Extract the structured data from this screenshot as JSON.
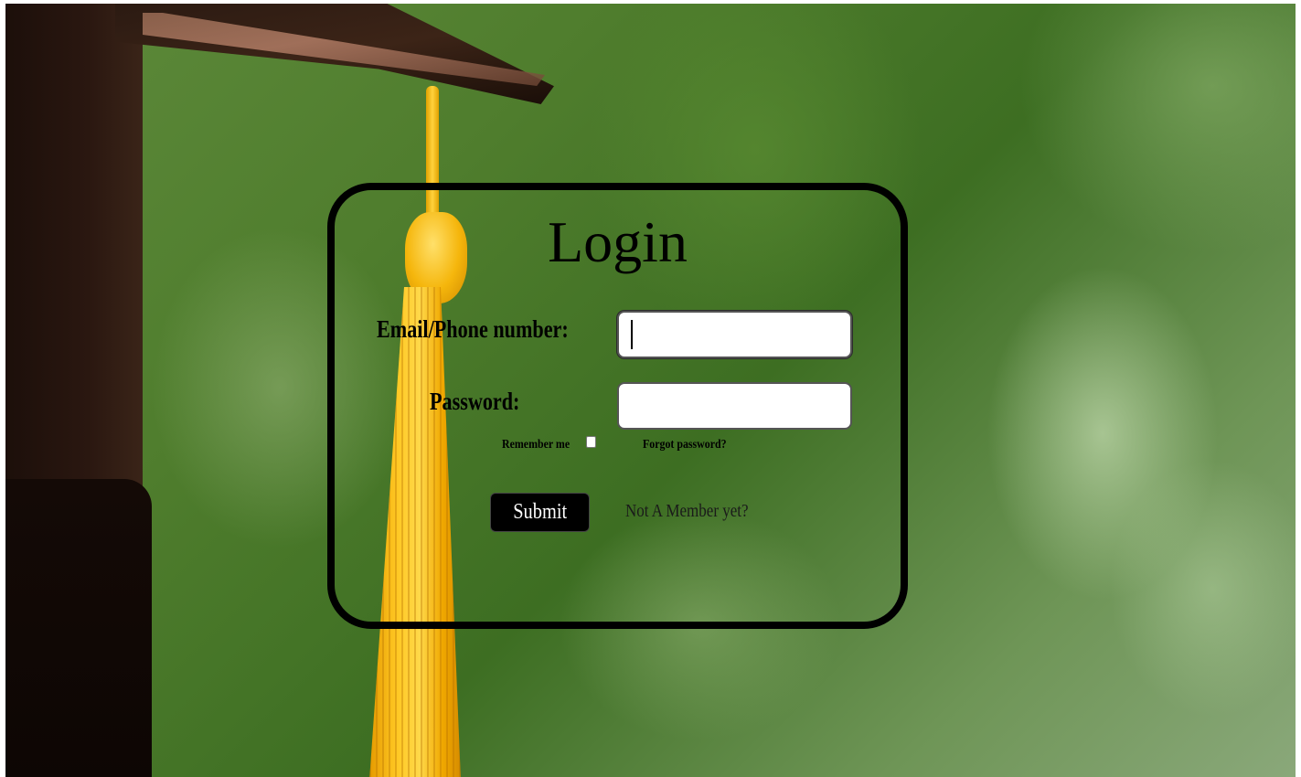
{
  "login": {
    "title": "Login",
    "email_label": "Email/Phone number:",
    "email_value": "",
    "password_label": "Password:",
    "password_value": "",
    "remember_label": "Remember me",
    "remember_checked": false,
    "forgot_label": "Forgot password?",
    "submit_label": "Submit",
    "signup_label": "Not A Member yet?"
  },
  "colors": {
    "card_border": "#000000",
    "button_bg": "#000000",
    "button_text": "#ffffff",
    "background_green": "#4f7d2d",
    "tassel_gold": "#ffc823"
  },
  "icons": {
    "background": "graduation-cap-tassel-photo"
  }
}
